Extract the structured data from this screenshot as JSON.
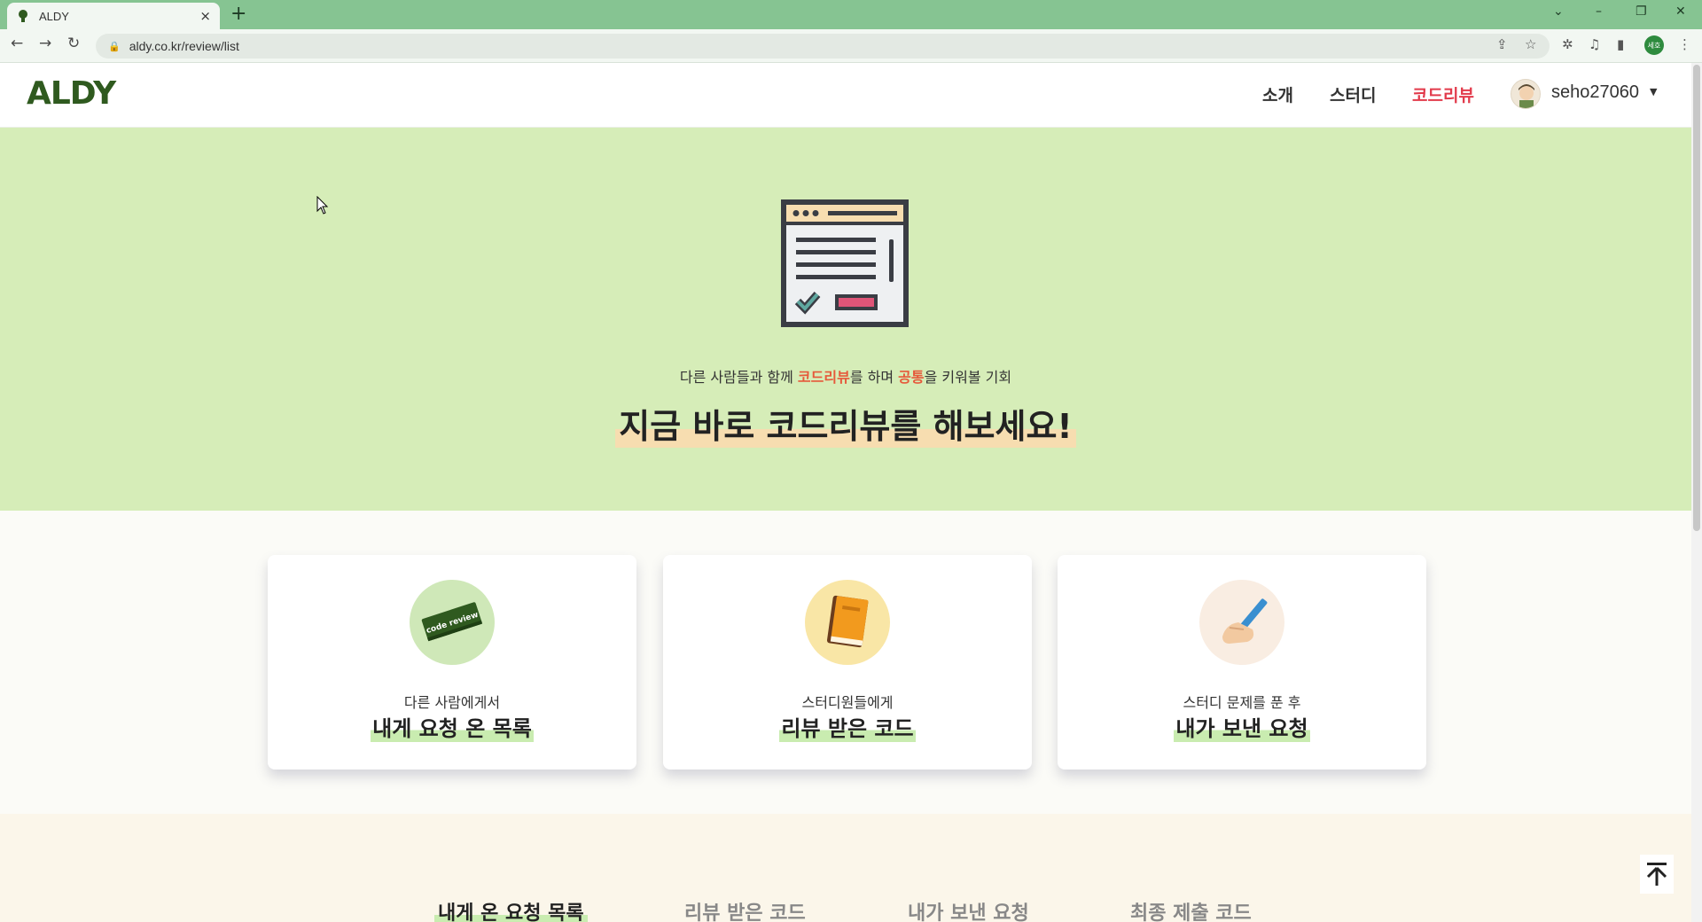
{
  "browser": {
    "tab_title": "ALDY",
    "tab_close": "×",
    "new_tab": "+",
    "url": "aldy.co.kr/review/list",
    "profile_initials": "세호"
  },
  "header": {
    "logo": "ALDY",
    "nav": [
      {
        "label": "소개"
      },
      {
        "label": "스터디"
      },
      {
        "label": "코드리뷰",
        "active": true
      }
    ],
    "username": "seho27060"
  },
  "hero": {
    "subtitle_parts": [
      "다른 사람들과 함께 ",
      "코드리뷰",
      "를 하며 ",
      "공통",
      "을 키워볼 기회"
    ],
    "title": "지금 바로 코드리뷰를 해보세요!"
  },
  "cards": [
    {
      "subtitle": "다른 사람에게서",
      "title": "내게 요청 온 목록",
      "icon": "code-review-badge-icon",
      "badge_text": "code review"
    },
    {
      "subtitle": "스터디원들에게",
      "title": "리뷰 받은 코드",
      "icon": "book-icon"
    },
    {
      "subtitle": "스터디 문제를 푼 후",
      "title": "내가 보낸 요청",
      "icon": "writing-hand-icon"
    }
  ],
  "bottom_tabs": [
    {
      "label": "내게 온 요청 목록",
      "active": true
    },
    {
      "label": "리뷰 받은 코드"
    },
    {
      "label": "내가 보낸 요청"
    },
    {
      "label": "최종 제출 코드"
    }
  ],
  "colors": {
    "chrome_tab_bar": "#86c492",
    "hero_bg": "#d6edb8",
    "logo": "#2f5a1f",
    "accent_red": "#e23a4b",
    "highlight_orange": "#e6593b"
  }
}
